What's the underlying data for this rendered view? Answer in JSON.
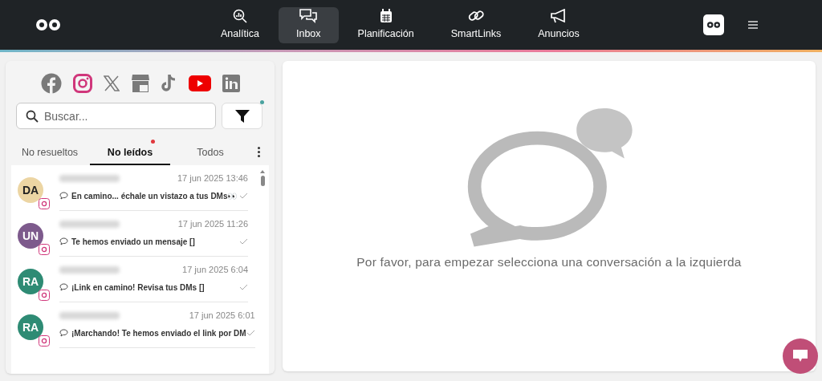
{
  "nav": [
    {
      "label": "Analítica",
      "selected": false
    },
    {
      "label": "Inbox",
      "selected": true
    },
    {
      "label": "Planificación",
      "selected": false
    },
    {
      "label": "SmartLinks",
      "selected": false
    },
    {
      "label": "Anuncios",
      "selected": false
    }
  ],
  "networks": [
    {
      "kind": "facebook",
      "selected": false
    },
    {
      "kind": "instagram",
      "selected": true
    },
    {
      "kind": "x",
      "selected": false
    },
    {
      "kind": "google",
      "selected": false
    },
    {
      "kind": "tiktok",
      "selected": false
    },
    {
      "kind": "youtube",
      "selected": true
    },
    {
      "kind": "linkedin",
      "selected": false
    }
  ],
  "search": {
    "placeholder": "Buscar..."
  },
  "filter": {
    "active": true
  },
  "tabs": [
    {
      "label": "No resueltos",
      "selected": false,
      "unread": false
    },
    {
      "label": "No leídos",
      "selected": true,
      "unread": true
    },
    {
      "label": "Todos",
      "selected": false,
      "unread": false
    }
  ],
  "conversations": [
    {
      "initials": "DA",
      "color": "#ecd5a3",
      "time": "17 jun 2025 13:46",
      "message": "En camino... échale un vistazo a tus DMs👀"
    },
    {
      "initials": "UN",
      "color": "#7d5a8c",
      "time": "17 jun 2025 11:26",
      "message": "Te hemos enviado un mensaje []"
    },
    {
      "initials": "RA",
      "color": "#2e8b74",
      "time": "17 jun 2025 6:04",
      "message": "¡Link en camino! Revisa tus DMs []"
    },
    {
      "initials": "RA",
      "color": "#2e8b74",
      "time": "17 jun 2025 6:01",
      "message": "¡Marchando! Te hemos enviado el link por DM"
    }
  ],
  "empty_state": {
    "message": "Por favor, para empezar selecciona una conversación a la izquierda"
  }
}
